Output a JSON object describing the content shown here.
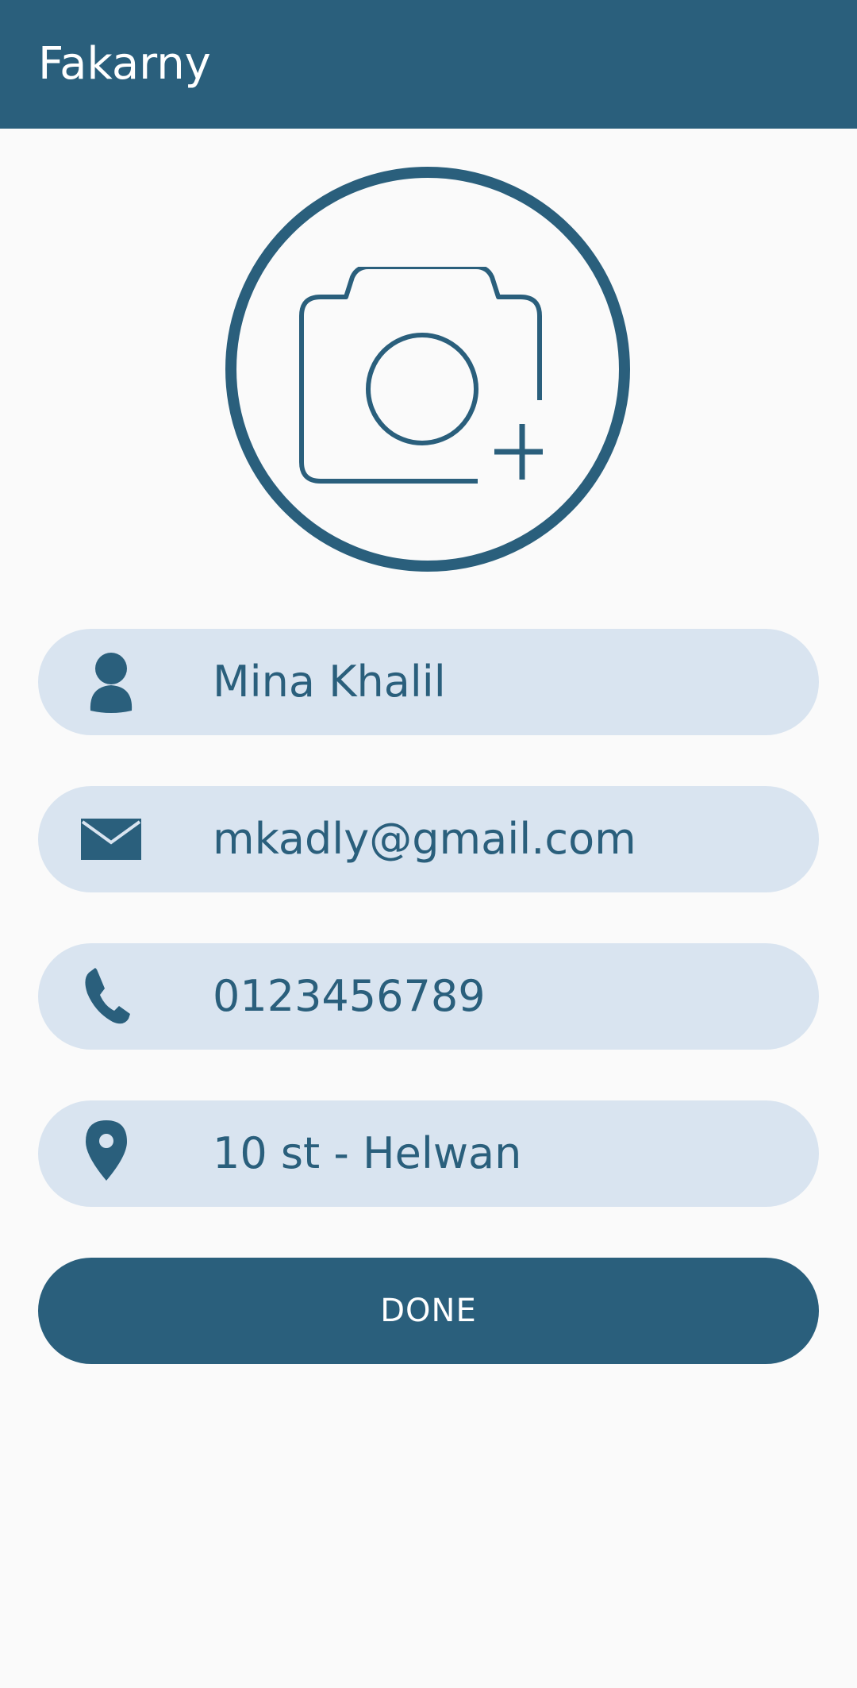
{
  "app_bar": {
    "title": "Fakarny",
    "color": "#2a5f7c"
  },
  "photo": {
    "icon": "camera-add-icon"
  },
  "fields": [
    {
      "icon": "person-icon",
      "value": "Mina Khalil"
    },
    {
      "icon": "email-icon",
      "value": "mkadly@gmail.com"
    },
    {
      "icon": "phone-icon",
      "value": "0123456789"
    },
    {
      "icon": "location-pin-icon",
      "value": "10 st - Helwan"
    }
  ],
  "done_button": {
    "label": "DONE"
  },
  "colors": {
    "primary": "#2a5f7c",
    "field_background": "#d9e4f0",
    "page_background": "#fafafa"
  }
}
